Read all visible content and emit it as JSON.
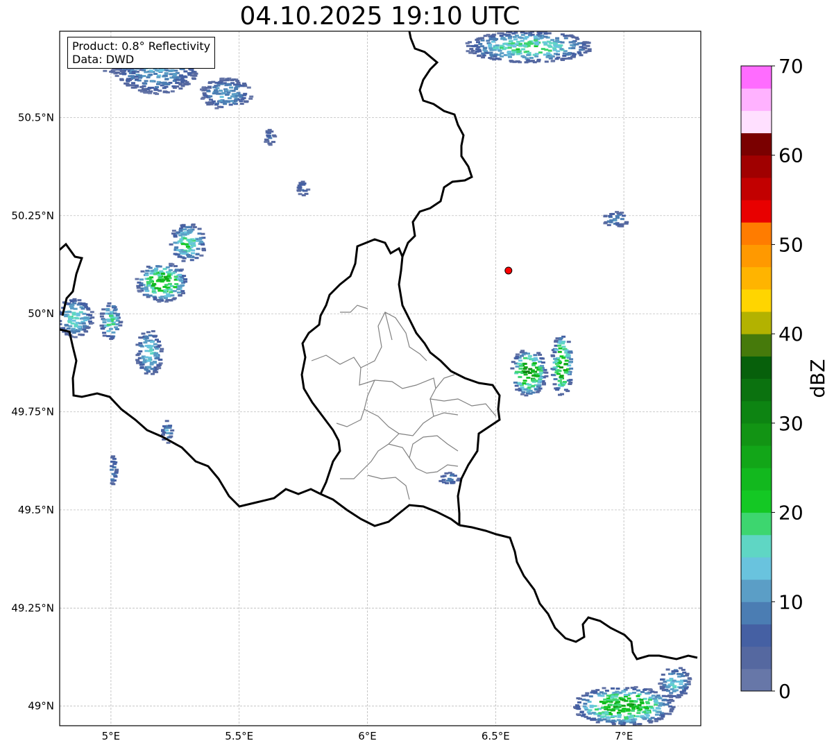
{
  "title": "04.10.2025 19:10 UTC",
  "info": {
    "product": "Product: 0.8° Reflectivity",
    "data": "Data: DWD"
  },
  "map": {
    "lon_range": [
      4.8,
      7.3
    ],
    "lat_range": [
      48.95,
      50.72
    ],
    "lon_ticks": [
      {
        "value": 5.0,
        "label": "5°E"
      },
      {
        "value": 5.5,
        "label": "5.5°E"
      },
      {
        "value": 6.0,
        "label": "6°E"
      },
      {
        "value": 6.5,
        "label": "6.5°E"
      },
      {
        "value": 7.0,
        "label": "7°E"
      }
    ],
    "lat_ticks": [
      {
        "value": 50.5,
        "label": "50.5°N"
      },
      {
        "value": 50.25,
        "label": "50.25°N"
      },
      {
        "value": 50.0,
        "label": "50°N"
      },
      {
        "value": 49.75,
        "label": "49.75°N"
      },
      {
        "value": 49.5,
        "label": "49.5°N"
      },
      {
        "value": 49.25,
        "label": "49.25°N"
      },
      {
        "value": 49.0,
        "label": "49°N"
      }
    ],
    "gridlines": true,
    "radar_site": {
      "lon": 6.55,
      "lat": 50.11,
      "color": "#ff0000"
    },
    "echo_clusters": [
      {
        "lon": 5.05,
        "lat": 50.65,
        "dlon": 0.12,
        "dlat": 0.04,
        "max_dbz": 14
      },
      {
        "lon": 5.18,
        "lat": 50.63,
        "dlon": 0.17,
        "dlat": 0.07,
        "max_dbz": 15
      },
      {
        "lon": 5.45,
        "lat": 50.56,
        "dlon": 0.1,
        "dlat": 0.04,
        "max_dbz": 14
      },
      {
        "lon": 6.63,
        "lat": 50.68,
        "dlon": 0.25,
        "dlat": 0.04,
        "max_dbz": 22
      },
      {
        "lon": 5.2,
        "lat": 50.08,
        "dlon": 0.1,
        "dlat": 0.05,
        "max_dbz": 29
      },
      {
        "lon": 5.3,
        "lat": 50.18,
        "dlon": 0.07,
        "dlat": 0.05,
        "max_dbz": 22
      },
      {
        "lon": 4.86,
        "lat": 49.99,
        "dlon": 0.07,
        "dlat": 0.05,
        "max_dbz": 20
      },
      {
        "lon": 5.0,
        "lat": 49.98,
        "dlon": 0.04,
        "dlat": 0.05,
        "max_dbz": 20
      },
      {
        "lon": 5.15,
        "lat": 49.9,
        "dlon": 0.05,
        "dlat": 0.06,
        "max_dbz": 18
      },
      {
        "lon": 5.22,
        "lat": 49.7,
        "dlon": 0.02,
        "dlat": 0.03,
        "max_dbz": 14
      },
      {
        "lon": 5.01,
        "lat": 49.6,
        "dlon": 0.015,
        "dlat": 0.04,
        "max_dbz": 12
      },
      {
        "lon": 6.63,
        "lat": 49.85,
        "dlon": 0.07,
        "dlat": 0.06,
        "max_dbz": 33
      },
      {
        "lon": 6.76,
        "lat": 49.87,
        "dlon": 0.04,
        "dlat": 0.08,
        "max_dbz": 32
      },
      {
        "lon": 7.0,
        "lat": 49.0,
        "dlon": 0.2,
        "dlat": 0.05,
        "max_dbz": 30
      },
      {
        "lon": 7.2,
        "lat": 49.06,
        "dlon": 0.06,
        "dlat": 0.04,
        "max_dbz": 18
      },
      {
        "lon": 6.32,
        "lat": 49.58,
        "dlon": 0.04,
        "dlat": 0.015,
        "max_dbz": 12
      },
      {
        "lon": 6.97,
        "lat": 50.24,
        "dlon": 0.05,
        "dlat": 0.02,
        "max_dbz": 12
      },
      {
        "lon": 5.75,
        "lat": 50.32,
        "dlon": 0.02,
        "dlat": 0.02,
        "max_dbz": 10
      },
      {
        "lon": 5.62,
        "lat": 50.45,
        "dlon": 0.02,
        "dlat": 0.02,
        "max_dbz": 8
      }
    ]
  },
  "colorbar": {
    "label": "dBZ",
    "min": 0,
    "max": 70,
    "step": 2.5,
    "tick_values": [
      0,
      10,
      20,
      30,
      40,
      50,
      60,
      70
    ],
    "tick_labels": [
      "0",
      "10",
      "20",
      "30",
      "40",
      "50",
      "60",
      "70"
    ],
    "colors": [
      "#6777a8",
      "#5568a0",
      "#4560a3",
      "#4b7db3",
      "#5b9ec6",
      "#69c3de",
      "#5fd6c4",
      "#3dd66f",
      "#14c824",
      "#12b81e",
      "#12a618",
      "#129414",
      "#0d8412",
      "#0b720f",
      "#07600b",
      "#467a0b",
      "#b3b200",
      "#ffd500",
      "#ffb400",
      "#ff9900",
      "#ff7c00",
      "#e80000",
      "#c20000",
      "#a00000",
      "#7a0000",
      "#ffe0ff",
      "#ffb2ff",
      "#ff6cff",
      "#ec38ec"
    ]
  }
}
